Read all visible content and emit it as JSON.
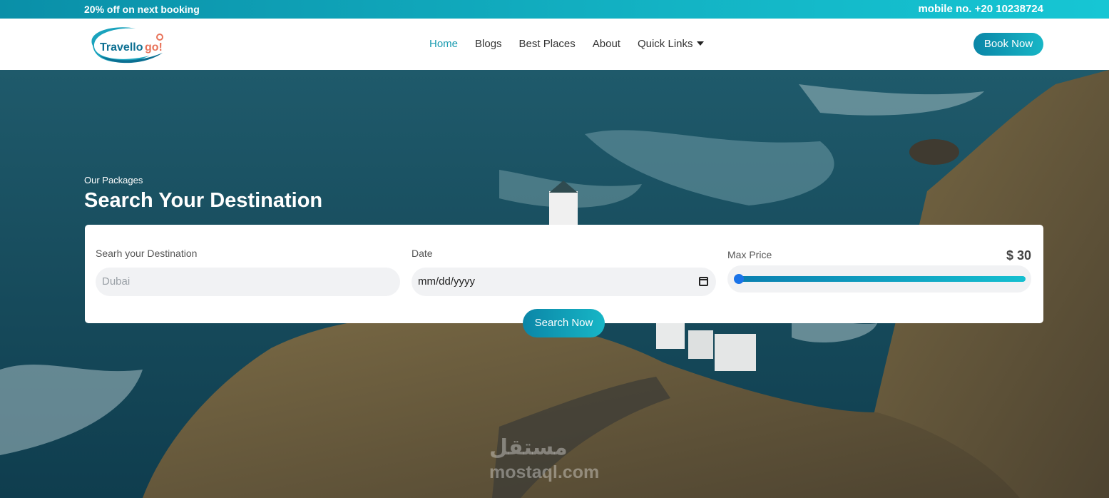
{
  "topbar": {
    "promo": "20% off on next booking",
    "phone": "mobile no. +20 10238724"
  },
  "header": {
    "logo_text": "Travellogo!",
    "nav": [
      {
        "label": "Home",
        "active": true
      },
      {
        "label": "Blogs"
      },
      {
        "label": "Best Places"
      },
      {
        "label": "About"
      },
      {
        "label": "Quick Links",
        "has_dropdown": true
      }
    ],
    "book_button": "Book Now"
  },
  "hero": {
    "kicker": "Our Packages",
    "title": "Search Your Destination",
    "search": {
      "destination_label": "Searh your Destination",
      "destination_placeholder": "Dubai",
      "date_label": "Date",
      "date_value": "mm/dd/yyyy",
      "price_label": "Max Price",
      "price_value": "$ 30",
      "price_fraction": 0.0,
      "button": "Search Now"
    },
    "watermark": {
      "arabic": "مستقل",
      "latin": "mostaql.com"
    }
  },
  "colors": {
    "accent": "#1a9bb0",
    "gradient_start": "#0b86a7",
    "gradient_end": "#17b6c6",
    "slider_thumb": "#1a73e8"
  },
  "icons": {
    "dropdown": "caret-down-icon",
    "date": "calendar-icon"
  }
}
